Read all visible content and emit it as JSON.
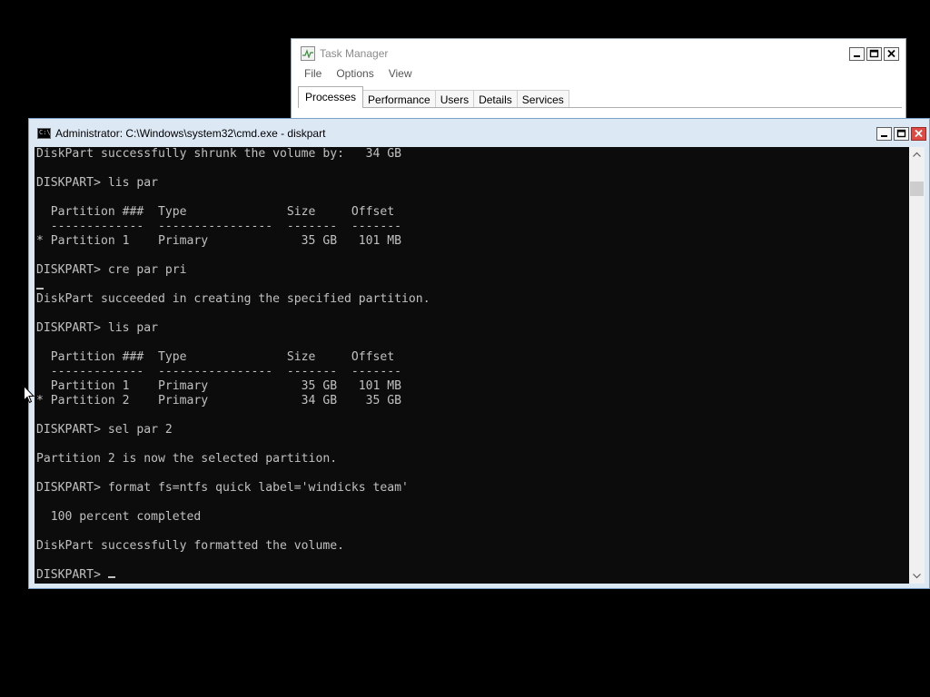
{
  "task_manager": {
    "title": "Task Manager",
    "menu": [
      "File",
      "Options",
      "View"
    ],
    "tabs": [
      "Processes",
      "Performance",
      "Users",
      "Details",
      "Services"
    ],
    "active_tab": "Processes"
  },
  "cmd": {
    "title": "Administrator: C:\\Windows\\system32\\cmd.exe - diskpart",
    "icon_text": "C:\\",
    "lines": [
      "DiskPart successfully shrunk the volume by:   34 GB",
      "",
      "DISKPART> lis par",
      "",
      "  Partition ###  Type              Size     Offset",
      "  -------------  ----------------  -------  -------",
      "* Partition 1    Primary             35 GB   101 MB",
      "",
      "DISKPART> cre par pri",
      "",
      "DiskPart succeeded in creating the specified partition.",
      "",
      "DISKPART> lis par",
      "",
      "  Partition ###  Type              Size     Offset",
      "  -------------  ----------------  -------  -------",
      "  Partition 1    Primary             35 GB   101 MB",
      "* Partition 2    Primary             34 GB    35 GB",
      "",
      "DISKPART> sel par 2",
      "",
      "Partition 2 is now the selected partition.",
      "",
      "DISKPART> format fs=ntfs quick label='windicks team'",
      "",
      "  100 percent completed",
      "",
      "DiskPart successfully formatted the volume.",
      "",
      "DISKPART> "
    ]
  },
  "icons": {
    "tm_app": "task-manager-icon",
    "cmd_app": "command-prompt-icon",
    "minimize": "minimize-icon",
    "maximize": "maximize-icon",
    "close": "close-icon",
    "scroll_up": "chevron-up-icon",
    "scroll_down": "chevron-down-icon",
    "pointer": "mouse-pointer-icon"
  },
  "colors": {
    "console_bg": "#0c0c0c",
    "console_text": "#c0c0c0",
    "close_button": "#e04a43"
  }
}
